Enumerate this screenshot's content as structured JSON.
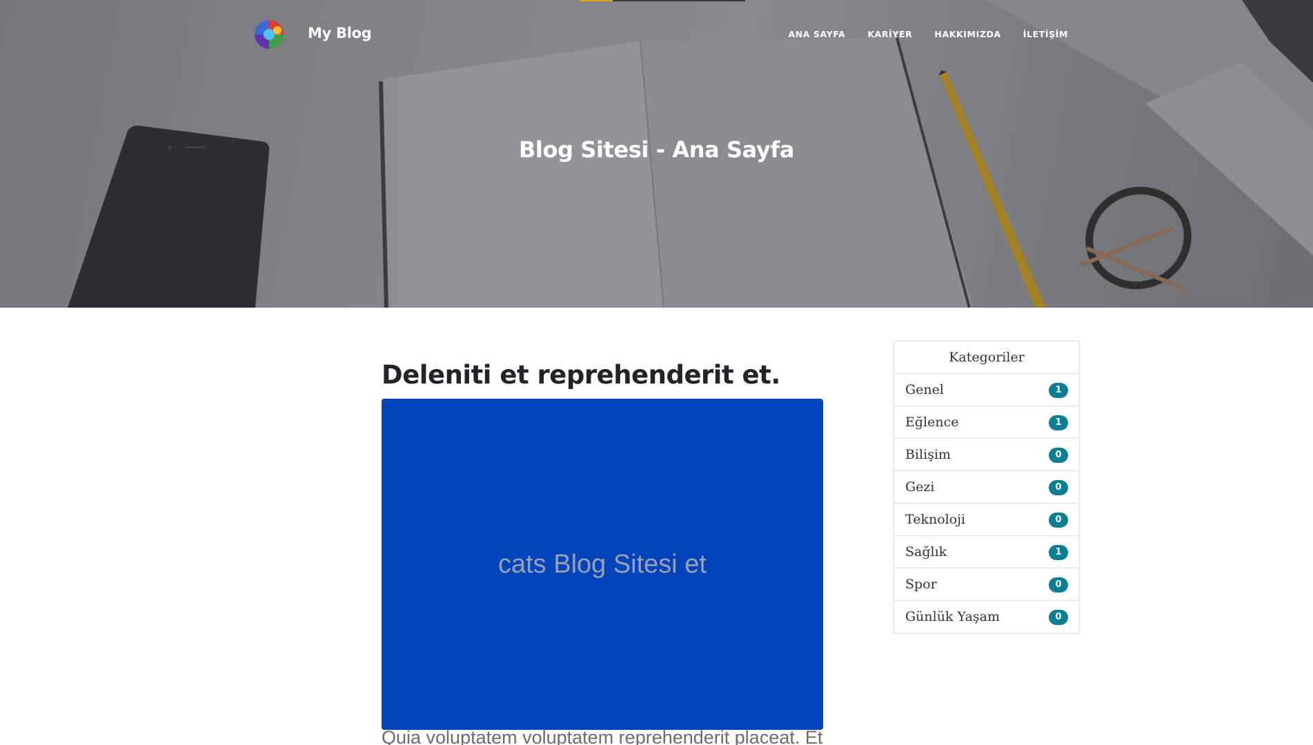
{
  "nav": {
    "brand": "My Blog",
    "links": [
      "ANA SAYFA",
      "KARİYER",
      "HAKKIMIZDA",
      "İLETİŞİM"
    ]
  },
  "hero": {
    "title": "Blog Sitesi - Ana Sayfa"
  },
  "post": {
    "title": "Deleniti et reprehenderit et.",
    "image_placeholder": "cats Blog Sitesi et",
    "excerpt": "Quia voluptatem voluptatem reprehenderit placeat. Et"
  },
  "sidebar": {
    "header": "Kategoriler",
    "categories": [
      {
        "label": "Genel",
        "count": "1"
      },
      {
        "label": "Eğlence",
        "count": "1"
      },
      {
        "label": "Bilişim",
        "count": "0"
      },
      {
        "label": "Gezi",
        "count": "0"
      },
      {
        "label": "Teknoloji",
        "count": "0"
      },
      {
        "label": "Sağlık",
        "count": "1"
      },
      {
        "label": "Spor",
        "count": "0"
      },
      {
        "label": "Günlük Yaşam",
        "count": "0"
      }
    ]
  },
  "colors": {
    "badge": "#0a7f94",
    "image_bg": "#0044bb",
    "accent": "#e0a418"
  }
}
